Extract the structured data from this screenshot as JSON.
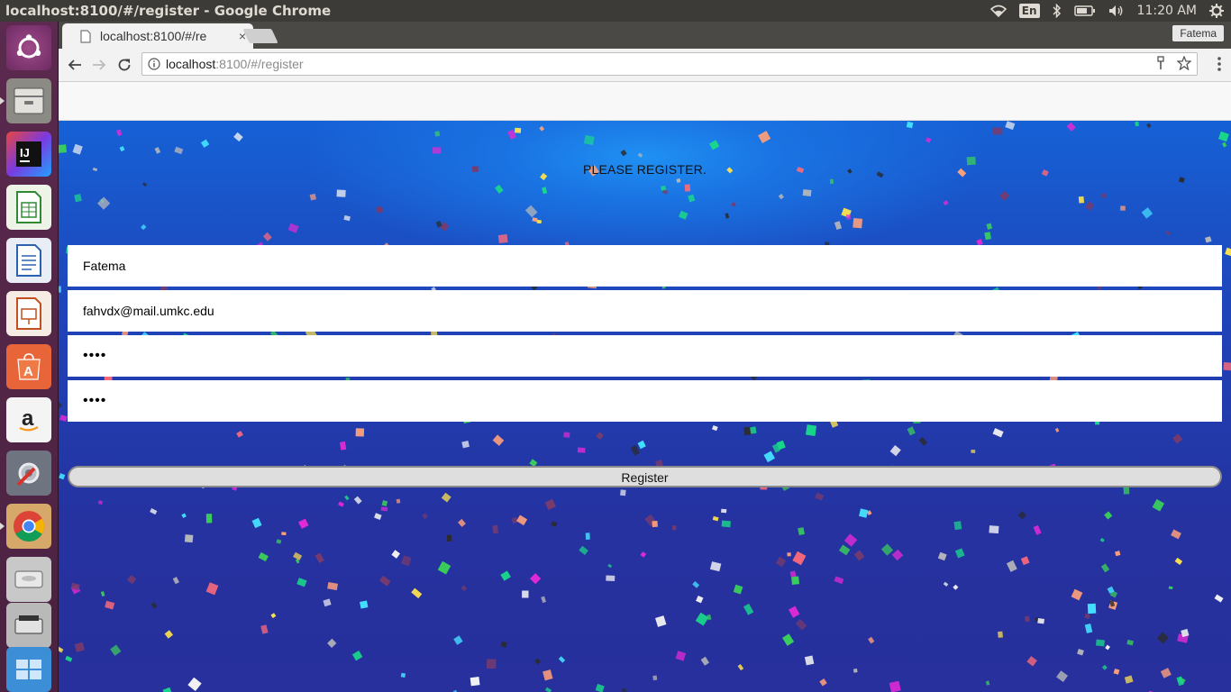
{
  "system_panel": {
    "window_title": "localhost:8100/#/register - Google Chrome",
    "language": "En",
    "clock": "11:20 AM"
  },
  "launcher": {
    "items": [
      {
        "name": "ubuntu-dash-icon"
      },
      {
        "name": "files-icon"
      },
      {
        "name": "intellij-icon",
        "label": "IJ"
      },
      {
        "name": "libreoffice-calc-icon"
      },
      {
        "name": "libreoffice-writer-icon"
      },
      {
        "name": "libreoffice-impress-icon"
      },
      {
        "name": "software-center-icon",
        "label": "A"
      },
      {
        "name": "amazon-icon",
        "label": "a"
      },
      {
        "name": "system-settings-icon"
      },
      {
        "name": "chrome-icon"
      },
      {
        "name": "drive-icon"
      },
      {
        "name": "scanner-icon"
      },
      {
        "name": "workspace-switcher-icon"
      }
    ]
  },
  "browser": {
    "tab_title": "localhost:8100/#/re",
    "tab_close": "×",
    "profile_name": "Fatema",
    "url_host": "localhost",
    "url_path": ":8100/#/register"
  },
  "register_page": {
    "title": "PLEASE REGISTER.",
    "fields": {
      "name_value": "Fatema",
      "email_value": "fahvdx@mail.umkc.edu",
      "password_value": "••••",
      "confirm_password_value": "••••"
    },
    "register_label": "Register"
  },
  "colors": {
    "panel": "#3c3b37",
    "launcher": "#5b2a4e",
    "page_bg_top": "#1661d6",
    "page_bg_bottom": "#27309c",
    "button": "#dedede"
  }
}
